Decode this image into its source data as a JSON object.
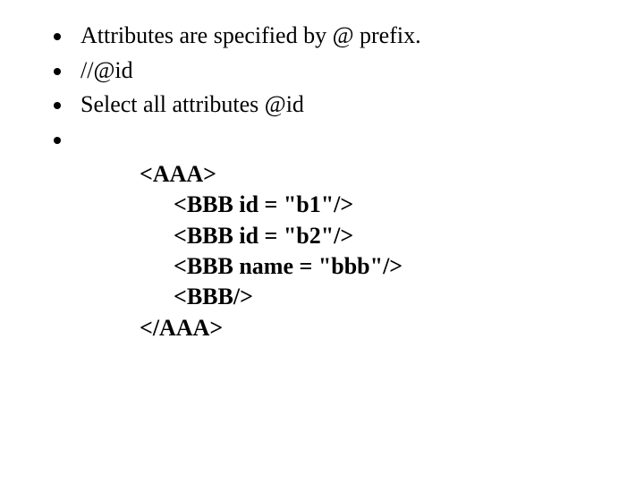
{
  "bullets": {
    "b1": "Attributes are specified by @ prefix.",
    "b2": "//@id",
    "b3": "Select all attributes @id",
    "b4": ""
  },
  "xml": {
    "open": "<AAA>",
    "l1": "<BBB id = \"b1\"/>",
    "l2": "<BBB id = \"b2\"/>",
    "l3": "<BBB name = \"bbb\"/>",
    "l4": "<BBB/>",
    "close": "</AAA>"
  }
}
